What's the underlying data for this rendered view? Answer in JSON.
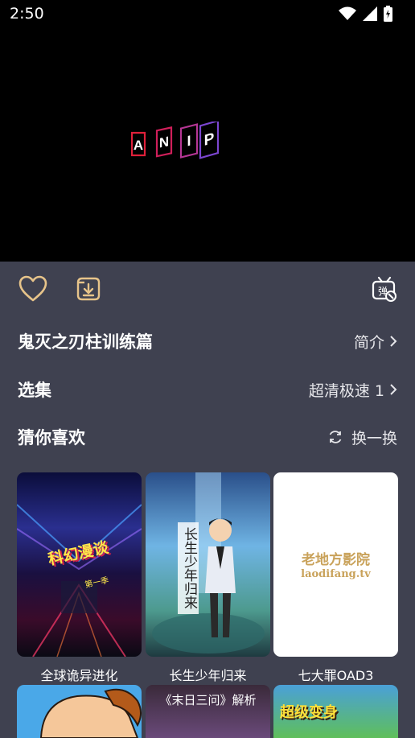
{
  "status": {
    "time": "2:50"
  },
  "player": {
    "logo_letters": [
      "A",
      "N",
      "I",
      "P"
    ]
  },
  "actions": {
    "favorite_icon": "heart-icon",
    "download_icon": "download-icon",
    "danmaku_icon": "danmaku-settings-icon",
    "danmaku_label": "弹"
  },
  "title_row": {
    "title": "鬼灭之刃柱训练篇",
    "intro_label": "简介"
  },
  "episode_row": {
    "label": "选集",
    "quality": "超清极速 1"
  },
  "recommend_row": {
    "label": "猜你喜欢",
    "refresh_label": "换一换"
  },
  "recommendations": [
    {
      "title": "全球诡异进化",
      "poster_text": "科幻漫谈",
      "poster_sub": "第一季"
    },
    {
      "title": "长生少年归来",
      "poster_text": "长生少年归来"
    },
    {
      "title": "七大罪OAD3",
      "poster_text": "老地方影院",
      "poster_sub": "laodifang.tv"
    }
  ],
  "recommendations_row2": [
    {
      "poster_text": ""
    },
    {
      "poster_text": "《末日三问》解析"
    },
    {
      "poster_text": "超级变身"
    }
  ],
  "colors": {
    "accent": "#e7c48a",
    "panel": "#3f4150"
  }
}
